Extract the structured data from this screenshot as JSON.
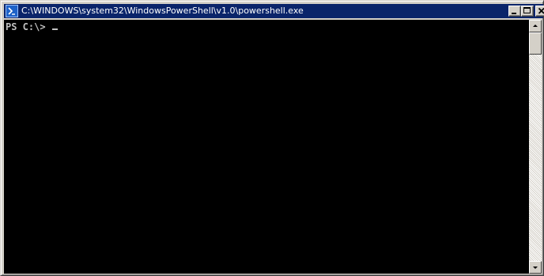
{
  "window": {
    "title": "C:\\WINDOWS\\system32\\WindowsPowerShell\\v1.0\\powershell.exe",
    "icon": "powershell-icon"
  },
  "controls": {
    "minimize_icon": "minimize-icon",
    "maximize_icon": "maximize-icon",
    "close_icon": "close-icon"
  },
  "console": {
    "prompt": "PS C:\\> ",
    "input": "",
    "background": "#000000",
    "foreground": "#c0c0c0"
  },
  "colors": {
    "titlebar": "#0a246a",
    "chrome": "#d4d0c8"
  }
}
